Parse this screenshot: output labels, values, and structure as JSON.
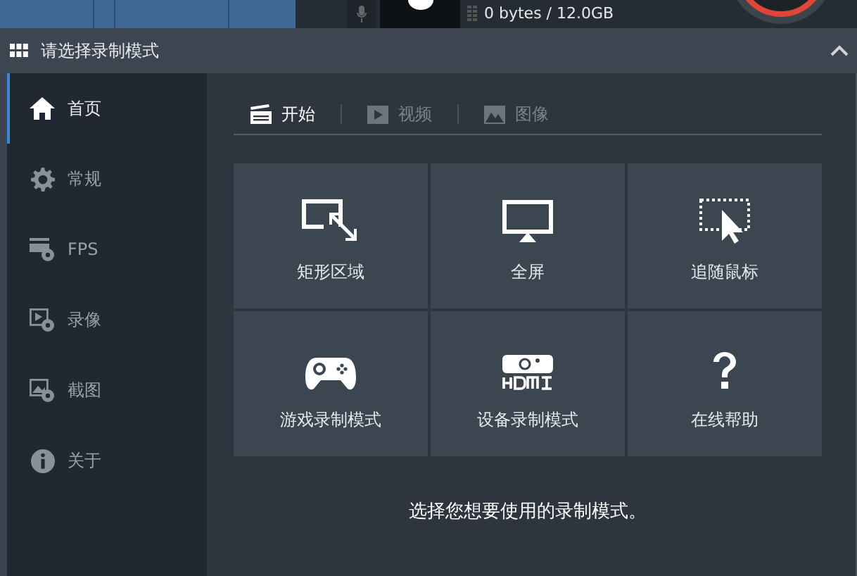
{
  "toolbar": {
    "storage": "0 bytes / 12.0GB"
  },
  "panel": {
    "title": "请选择录制模式",
    "expanded": true
  },
  "sidebar": {
    "items": [
      {
        "label": "首页",
        "selected": true
      },
      {
        "label": "常规",
        "selected": false
      },
      {
        "label": "FPS",
        "selected": false
      },
      {
        "label": "录像",
        "selected": false
      },
      {
        "label": "截图",
        "selected": false
      },
      {
        "label": "关于",
        "selected": false
      }
    ]
  },
  "tabs": [
    {
      "label": "开始",
      "selected": true
    },
    {
      "label": "视频",
      "selected": false
    },
    {
      "label": "图像",
      "selected": false
    }
  ],
  "modes": [
    {
      "label": "矩形区域"
    },
    {
      "label": "全屏"
    },
    {
      "label": "追随鼠标"
    },
    {
      "label": "游戏录制模式"
    },
    {
      "label": "设备录制模式"
    },
    {
      "label": "在线帮助"
    }
  ],
  "hint": "选择您想要使用的录制模式。"
}
